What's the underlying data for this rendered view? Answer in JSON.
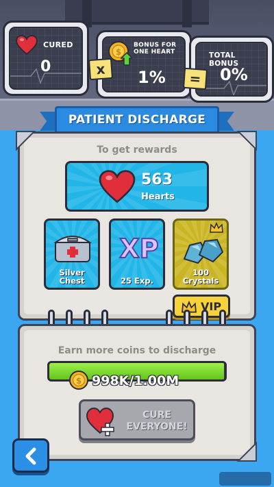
{
  "monitors": {
    "cured": {
      "label": "CURED",
      "value": "0"
    },
    "bonus": {
      "label": "BONUS FOR ONE HEART",
      "value": "1%"
    },
    "total": {
      "label": "TOTAL BONUS",
      "value": "0%"
    },
    "multiply_symbol": "x",
    "equals_symbol": "="
  },
  "title": "PATIENT DISCHARGE",
  "rewards_section": {
    "label": "To get rewards",
    "hearts": {
      "amount": "563",
      "label": "Hearts"
    },
    "items": [
      {
        "label": "Silver Chest",
        "icon": "silver-chest-icon"
      },
      {
        "label": "25 Exp.",
        "icon": "xp-icon",
        "icon_text": "XP"
      },
      {
        "label": "100 Crystals",
        "icon": "crystals-icon",
        "locked_vip": true
      }
    ],
    "vip_label": "VIP"
  },
  "discharge_section": {
    "label": "Earn more coins to discharge",
    "progress_text": "998K/1.00M",
    "progress_fraction": 0.998,
    "cure_button": "CURE EVERYONE!"
  },
  "colors": {
    "panel": "#e9e5e1",
    "card_blue": "#22b6e8",
    "card_gold": "#c9b521",
    "progress_green": "#7ed930",
    "background": "#3aa7f0",
    "heart_red": "#e02f3a"
  }
}
